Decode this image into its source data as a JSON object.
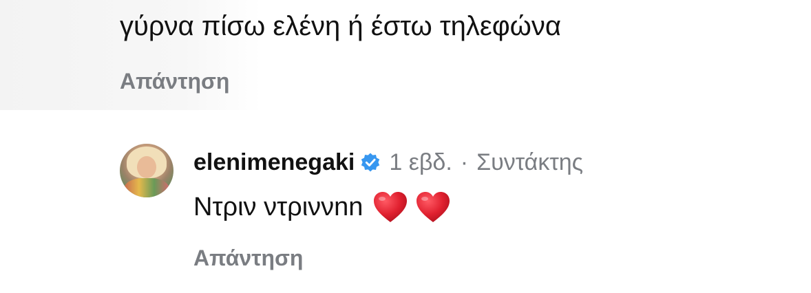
{
  "comment_parent": {
    "text": "γύρνα πίσω ελένη ή έστω τηλεφώνα",
    "reply_label": "Απάντηση"
  },
  "comment_reply": {
    "username": "elenimenegaki",
    "verified": true,
    "time": "1 εβδ.",
    "separator": "·",
    "role": "Συντάκτης",
    "text": "Ντριν ντριννnn",
    "emojis": [
      "red-heart",
      "red-heart"
    ],
    "reply_label": "Απάντηση"
  },
  "colors": {
    "text": "#111111",
    "muted": "#7a7d82",
    "verified_blue": "#3797f0",
    "heart_red": "#e0202f"
  }
}
